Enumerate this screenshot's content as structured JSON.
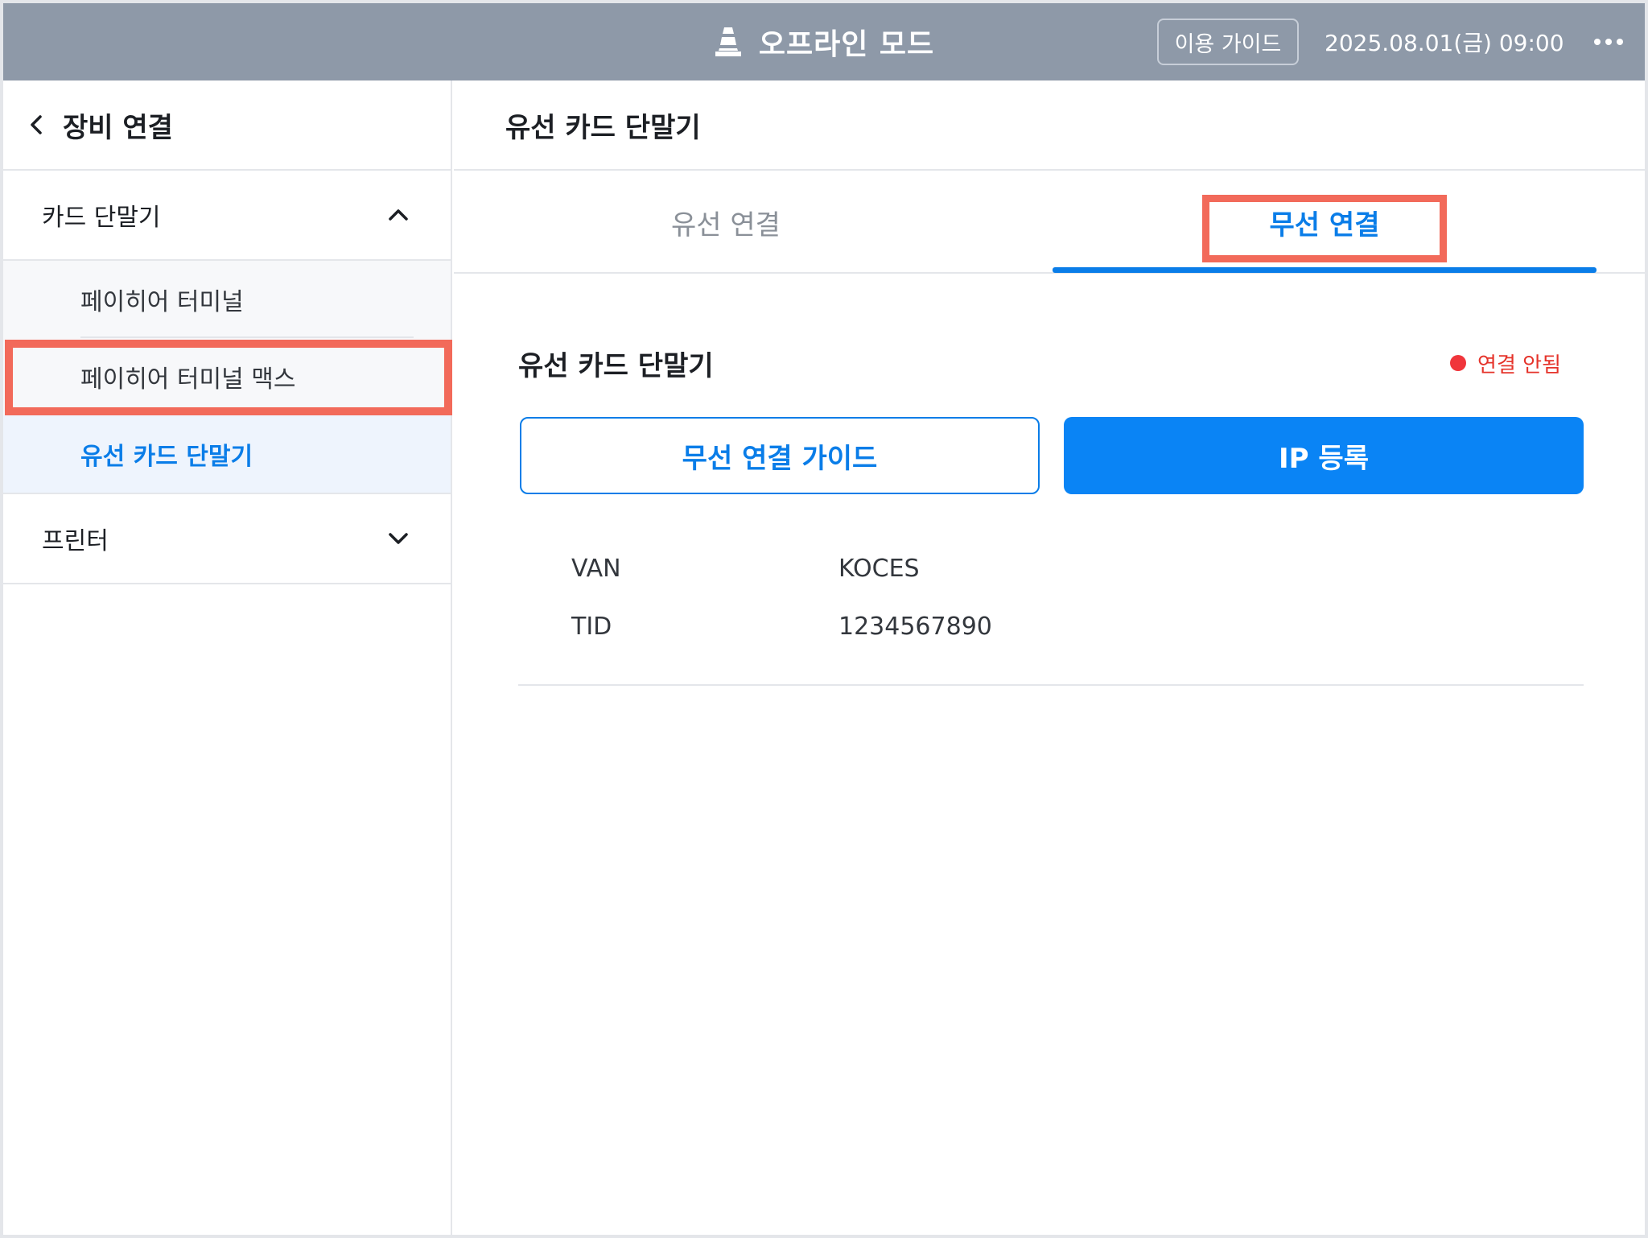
{
  "topbar": {
    "title": "오프라인 모드",
    "guide_button": "이용 가이드",
    "datetime": "2025.08.01(금) 09:00"
  },
  "sidebar": {
    "header": "장비 연결",
    "groups": [
      {
        "label": "카드 단말기",
        "expanded": true,
        "items": [
          {
            "label": "페이히어 터미널"
          },
          {
            "label": "페이히어 터미널 맥스"
          },
          {
            "label": "유선 카드 단말기",
            "active": true
          }
        ]
      },
      {
        "label": "프린터",
        "expanded": false
      }
    ]
  },
  "main": {
    "header": "유선 카드 단말기",
    "tabs": [
      {
        "label": "유선 연결",
        "active": false
      },
      {
        "label": "무선 연결",
        "active": true
      }
    ],
    "section_title": "유선 카드 단말기",
    "status": "연결 안됨",
    "guide_button": "무선 연결 가이드",
    "ip_button": "IP 등록",
    "info": [
      {
        "key": "VAN",
        "value": "KOCES"
      },
      {
        "key": "TID",
        "value": "1234567890"
      }
    ]
  },
  "colors": {
    "accent": "#0a7de8",
    "topbar": "#8e99a8",
    "status_error": "#e5332a",
    "highlight": "#f26a5a"
  }
}
